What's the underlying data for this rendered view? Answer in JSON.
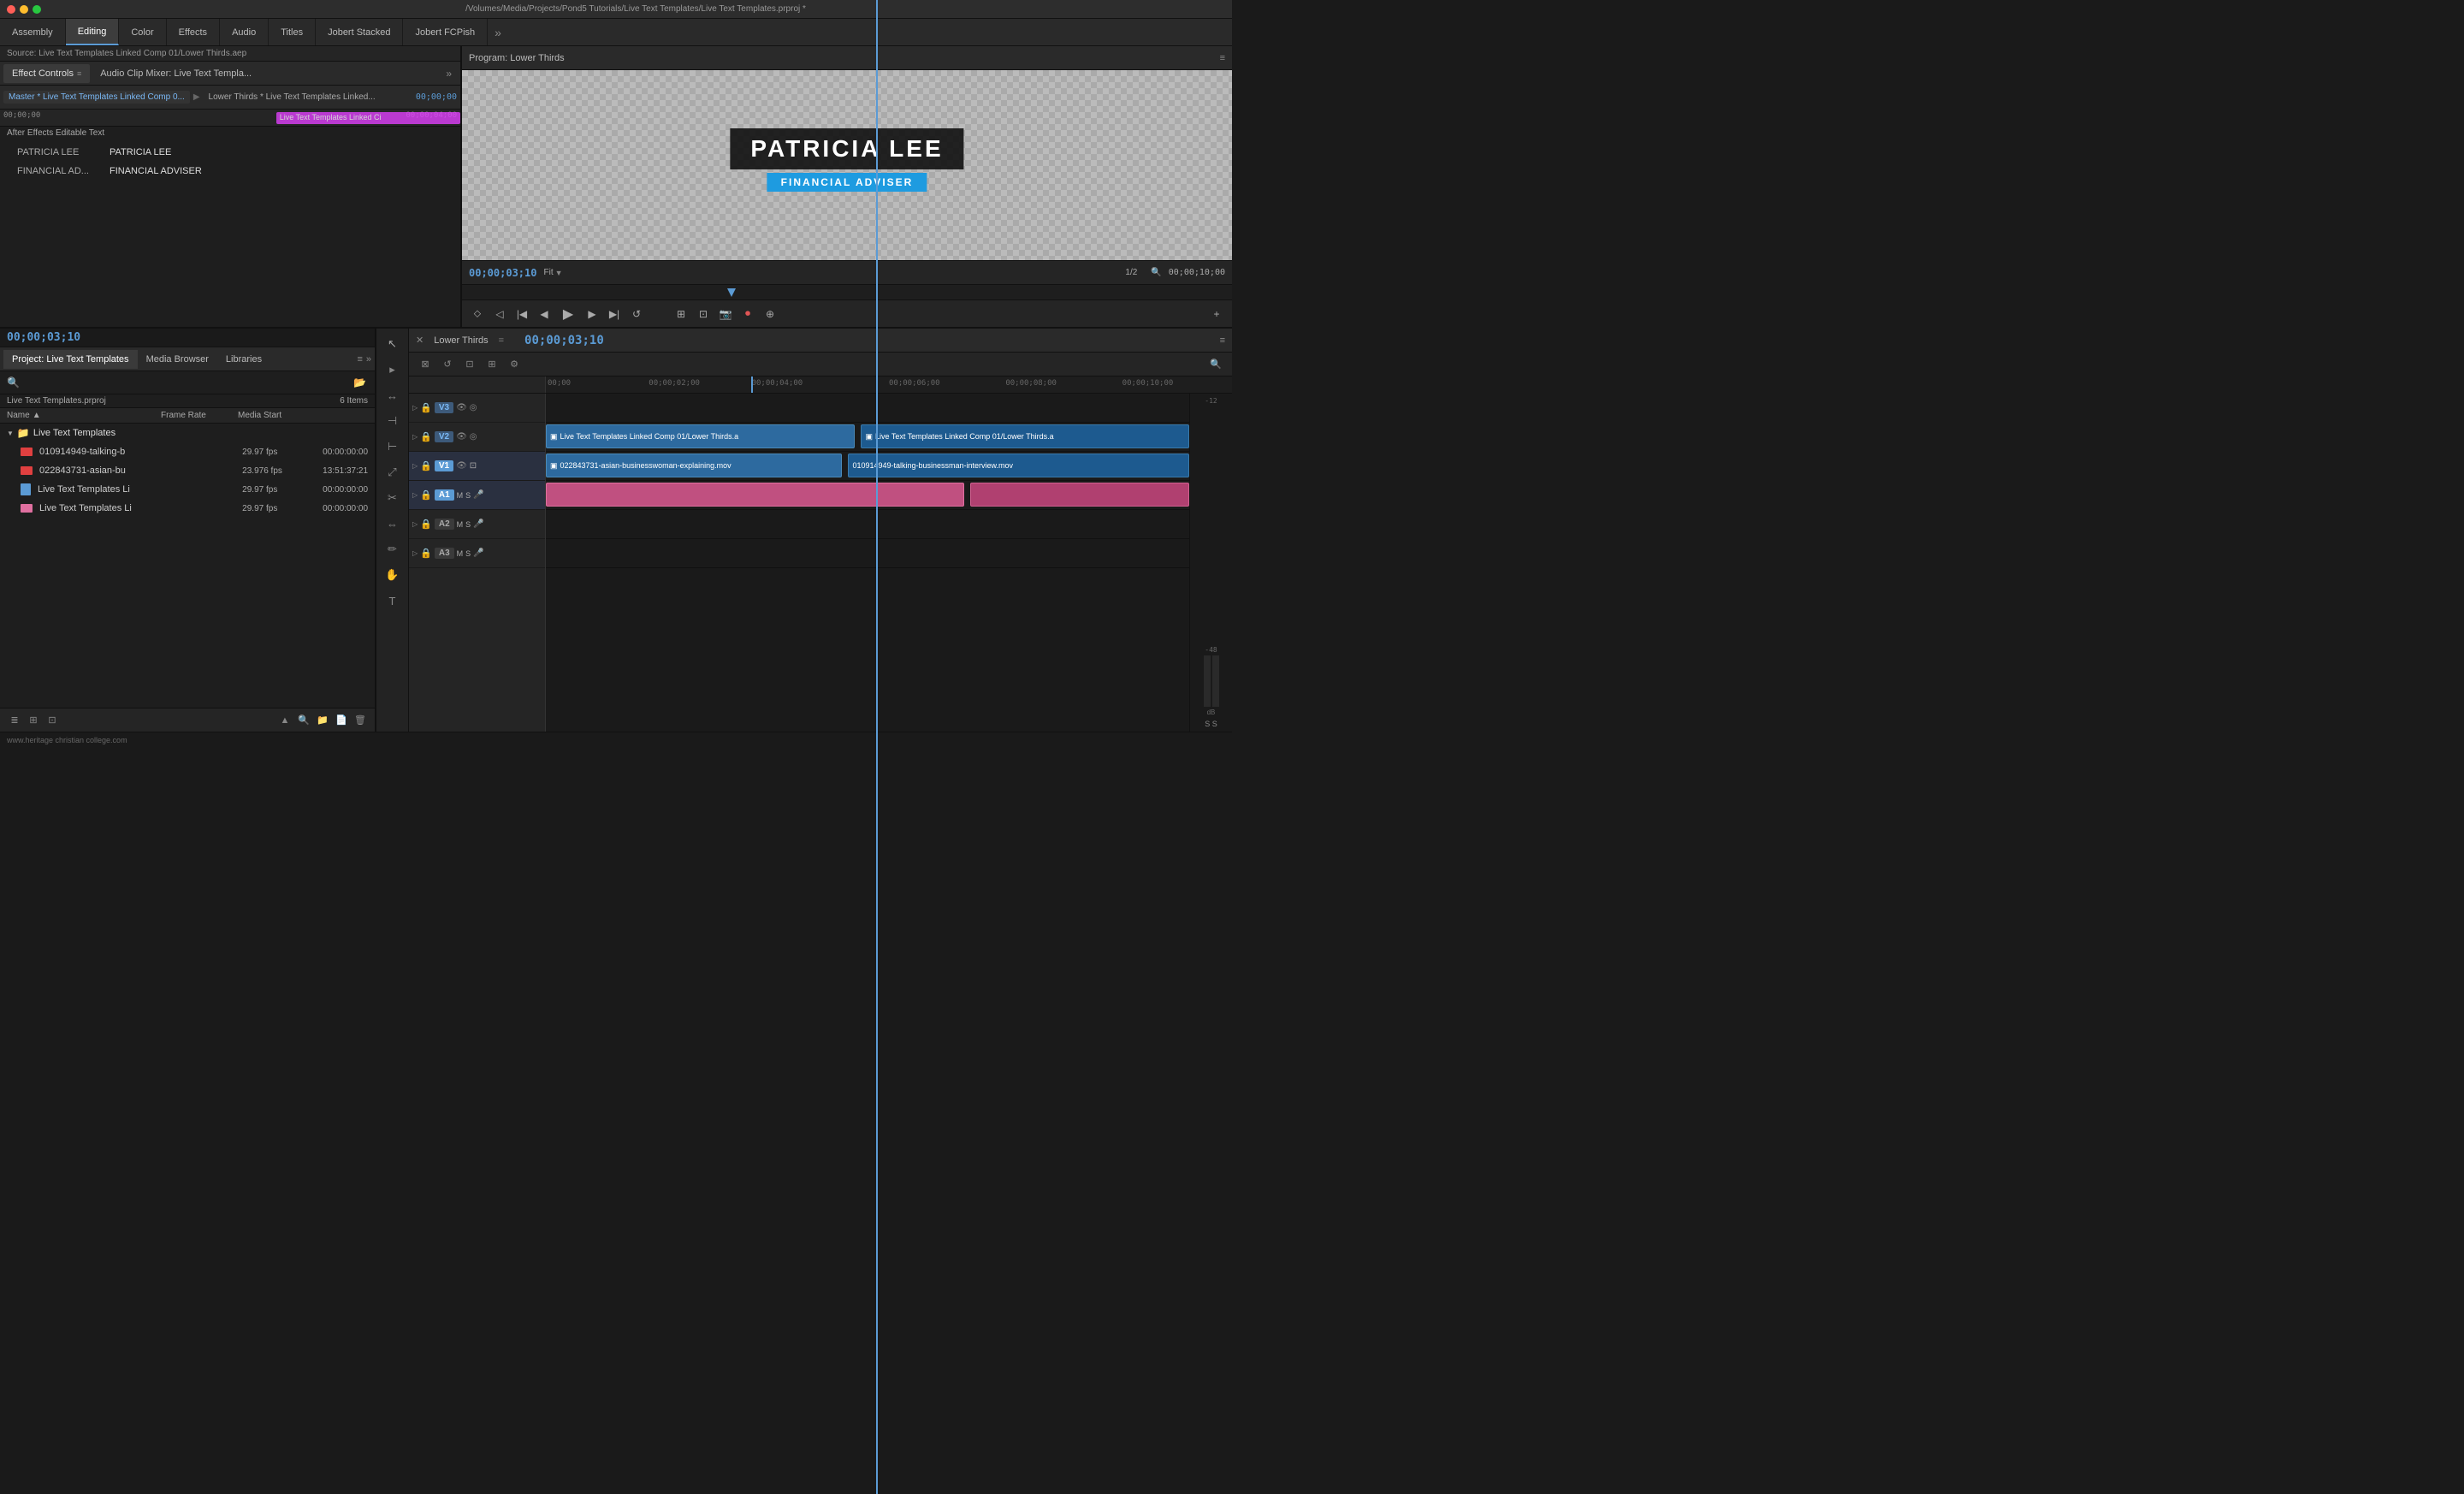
{
  "window": {
    "title": "/Volumes/Media/Projects/Pond5 Tutorials/Live Text Templates/Live Text Templates.prproj *"
  },
  "nav": {
    "items": [
      "Assembly",
      "Editing",
      "Color",
      "Effects",
      "Audio",
      "Titles",
      "Jobert Stacked",
      "Jobert FCPish"
    ],
    "active": "Editing"
  },
  "effect_controls": {
    "tab_label": "Effect Controls",
    "audio_mixer_label": "Audio Clip Mixer: Live Text Templa...",
    "source": "Master * Live Text Templates Linked Comp 0...",
    "target": "Lower Thirds * Live Text Templates Linked...",
    "source_label": "Source: Live Text Templates Linked Comp 01/Lower Thirds.aep",
    "timecode_start": "00;00;00",
    "timecode_end": "00;00;04;00",
    "ae_text_label": "After Effects Editable Text",
    "fields": [
      {
        "key": "PATRICIA LEE",
        "value": "PATRICIA LEE"
      },
      {
        "key": "FINANCIAL AD...",
        "value": "FINANCIAL ADVISER"
      }
    ],
    "clip_label": "Live Text Templates Linked Ci"
  },
  "program_monitor": {
    "title": "Program: Lower Thirds",
    "timecode_current": "00;00;03;10",
    "fit_label": "Fit",
    "ratio": "1/2",
    "timecode_total": "00;00;10;00",
    "name_display": "PATRICIA LEE",
    "title_display": "FINANCIAL ADVISER",
    "transport": {
      "buttons": [
        "⏮",
        "◀◀",
        "◀",
        "▶",
        "▶▶",
        "⏭"
      ]
    }
  },
  "project_panel": {
    "title": "Project: Live Text Templates",
    "tabs": [
      "Project: Live Text Templates",
      "Media Browser",
      "Libraries"
    ],
    "active_tab": "Project: Live Text Templates",
    "project_name": "Live Text Templates.prproj",
    "item_count": "6 Items",
    "columns": {
      "name": "Name",
      "frame_rate": "Frame Rate",
      "media_start": "Media Start"
    },
    "folders": [
      {
        "name": "Live Text Templates",
        "files": [
          {
            "name": "010914949-talking-b",
            "fps": "29.97 fps",
            "media_start": "00:00:00:00",
            "color": "red"
          },
          {
            "name": "022843731-asian-bu",
            "fps": "23.976 fps",
            "media_start": "13:51:37:21",
            "color": "red"
          },
          {
            "name": "Live Text Templates Li",
            "fps": "29.97 fps",
            "media_start": "00:00:00:00",
            "color": "doc"
          },
          {
            "name": "Live Text Templates Li",
            "fps": "29.97 fps",
            "media_start": "00:00:00:00",
            "color": "pink"
          }
        ]
      }
    ]
  },
  "timeline": {
    "title": "Lower Thirds",
    "timecode": "00;00;03;10",
    "ruler_labels": [
      "00;00",
      "00;00;02;00",
      "00;00;04;00",
      "00;00;06;00",
      "00;00;08;00",
      "00;00;10;00"
    ],
    "tracks": [
      {
        "id": "V3",
        "type": "video"
      },
      {
        "id": "V2",
        "type": "video"
      },
      {
        "id": "V1",
        "type": "video",
        "active": true
      },
      {
        "id": "A1",
        "type": "audio",
        "active": true
      },
      {
        "id": "A2",
        "type": "audio"
      },
      {
        "id": "A3",
        "type": "audio"
      }
    ],
    "clips": {
      "v2_left": "Live Text Templates Linked Comp 01/Lower Thirds.a",
      "v2_right": "Live Text Templates Linked Comp 01/Lower Thirds.a",
      "v1_left": "022843731-asian-businesswoman-explaining.mov",
      "v1_right": "010914949-talking-businessman-interview.mov"
    }
  },
  "audio_meter": {
    "labels": [
      "-12",
      "-48",
      "dB"
    ],
    "s_label": "S S"
  },
  "timecode_display": {
    "time": "00;00;03;10"
  },
  "status_bar": {
    "text": "www.heritage christian college.com"
  },
  "icons": {
    "search": "🔍",
    "folder": "📁",
    "new_folder": "📂",
    "settings": "⚙",
    "menu": "≡",
    "close": "✕",
    "lock": "🔒",
    "eye": "👁",
    "up_arrow": "▲",
    "down_arrow": "▼",
    "expand": "▶",
    "collapse": "▼",
    "play": "▶",
    "stop": "■",
    "record": "⏺",
    "list": "≣",
    "grid": "⊞"
  }
}
